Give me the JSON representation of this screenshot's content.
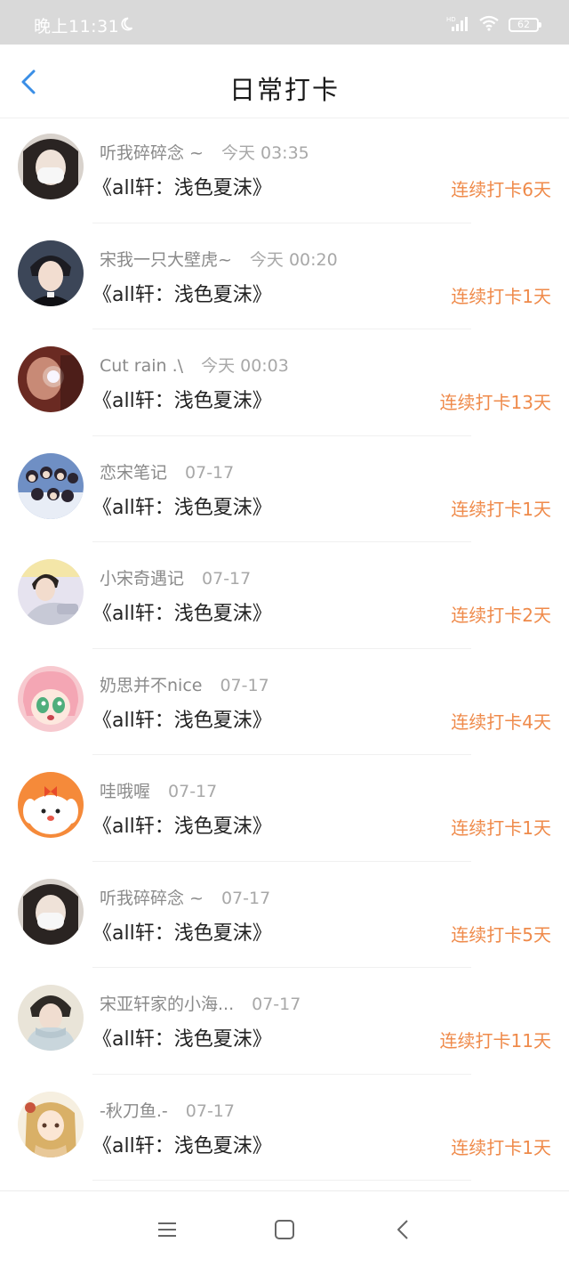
{
  "status_bar": {
    "time": "晚上11:31",
    "battery": "62",
    "icons": [
      "moon-icon",
      "signal-icon",
      "wifi-icon",
      "battery-icon"
    ]
  },
  "header": {
    "title": "日常打卡",
    "back_icon": "chevron-left-icon"
  },
  "colors": {
    "accent": "#3a8ee6",
    "streak": "#ef8a4a",
    "status_bar_bg": "#d9d9d9"
  },
  "checkins": [
    {
      "user": "听我碎碎念 ~",
      "time": "今天 03:35",
      "book": "《all轩：浅色夏沫》",
      "streak": "连续打卡6天"
    },
    {
      "user": "宋我一只大壁虎~",
      "time": "今天 00:20",
      "book": "《all轩：浅色夏沫》",
      "streak": "连续打卡1天"
    },
    {
      "user": "Cut rain .\\",
      "time": "今天 00:03",
      "book": "《all轩：浅色夏沫》",
      "streak": "连续打卡13天"
    },
    {
      "user": "恋宋笔记",
      "time": "07-17",
      "book": "《all轩：浅色夏沫》",
      "streak": "连续打卡1天"
    },
    {
      "user": "小宋奇遇记",
      "time": "07-17",
      "book": "《all轩：浅色夏沫》",
      "streak": "连续打卡2天"
    },
    {
      "user": "奶思并不nice",
      "time": "07-17",
      "book": "《all轩：浅色夏沫》",
      "streak": "连续打卡4天"
    },
    {
      "user": "哇哦喔",
      "time": "07-17",
      "book": "《all轩：浅色夏沫》",
      "streak": "连续打卡1天"
    },
    {
      "user": "听我碎碎念 ~",
      "time": "07-17",
      "book": "《all轩：浅色夏沫》",
      "streak": "连续打卡5天"
    },
    {
      "user": "宋亚轩家的小海...",
      "time": "07-17",
      "book": "《all轩：浅色夏沫》",
      "streak": "连续打卡11天"
    },
    {
      "user": "-秋刀鱼.-",
      "time": "07-17",
      "book": "《all轩：浅色夏沫》",
      "streak": "连续打卡1天"
    }
  ],
  "nav_bar": {
    "icons": [
      "menu-icon",
      "home-square-icon",
      "back-triangle-icon"
    ]
  }
}
